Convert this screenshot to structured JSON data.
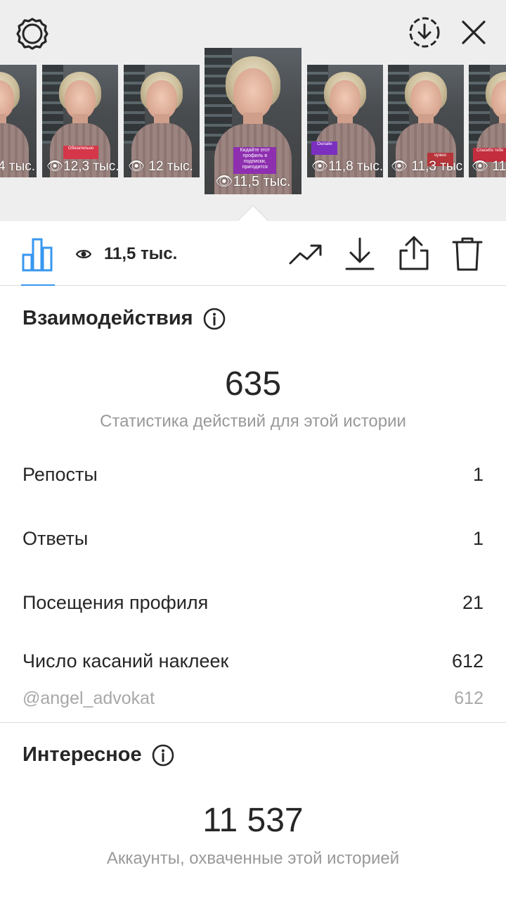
{
  "thumbnails": [
    {
      "views": "4 тыс."
    },
    {
      "views": "12,3 тыс.",
      "sticker": "Обязательно"
    },
    {
      "views": "12 тыс."
    },
    {
      "views": "11,5 тыс.",
      "sticker": "Кидайте этот профиль в подписки, пригодится"
    },
    {
      "views": "11,8 тыс.",
      "sticker": "Онлайн"
    },
    {
      "views": "11,3 тыс.",
      "sticker": "нужно"
    },
    {
      "views": "11",
      "sticker": "Спасибо тебе"
    }
  ],
  "toolbar": {
    "views": "11,5 тыс."
  },
  "interactions": {
    "title": "Взаимодействия",
    "total": "635",
    "subtitle": "Статистика действий для этой истории",
    "rows": [
      {
        "label": "Репосты",
        "value": "1"
      },
      {
        "label": "Ответы",
        "value": "1"
      },
      {
        "label": "Посещения профиля",
        "value": "21"
      },
      {
        "label": "Число касаний наклеек",
        "value": "612"
      }
    ],
    "sticker_row": {
      "label": "@angel_advokat",
      "value": "612"
    }
  },
  "discovery": {
    "title": "Интересное",
    "total": "11 537",
    "subtitle": "Аккаунты, охваченные этой историей"
  },
  "colors": {
    "accent": "#3897f0",
    "text": "#262626",
    "muted": "#999999",
    "divider": "#dbdbdb"
  },
  "icons": [
    "settings-icon",
    "download-circle-icon",
    "close-icon",
    "bar-chart-icon",
    "eye-icon",
    "trend-icon",
    "download-icon",
    "share-icon",
    "trash-icon",
    "info-icon"
  ]
}
